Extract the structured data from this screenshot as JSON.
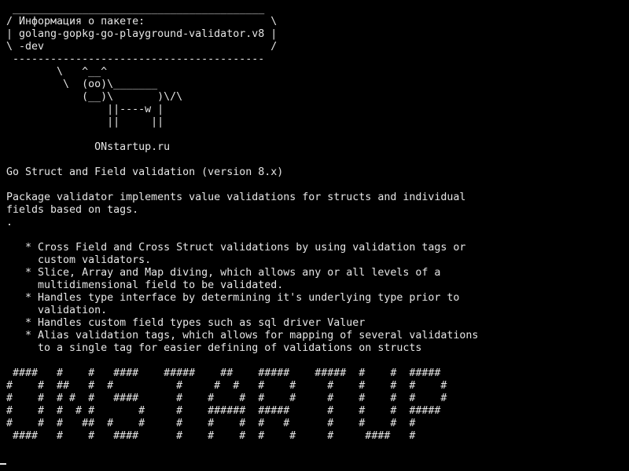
{
  "terminal": {
    "lines": [
      " ________________________________________",
      "/ Информация о пакете:                    \\",
      "| golang-gopkg-go-playground-validator.v8 |",
      "\\ -dev                                    /",
      " ----------------------------------------",
      "        \\   ^__^",
      "         \\  (oo)\\_______",
      "            (__)\\       )\\/\\",
      "                ||----w |",
      "                ||     ||",
      "",
      "              ONstartup.ru",
      "",
      "Go Struct and Field validation (version 8.x)",
      "",
      "Package validator implements value validations for structs and individual",
      "fields based on tags.",
      ".",
      "",
      "   * Cross Field and Cross Struct validations by using validation tags or",
      "     custom validators.",
      "   * Slice, Array and Map diving, which allows any or all levels of a",
      "     multidimensional field to be validated.",
      "   * Handles type interface by determining it's underlying type prior to",
      "     validation.",
      "   * Handles custom field types such as sql driver Valuer",
      "   * Alias validation tags, which allows for mapping of several validations",
      "     to a single tag for easier defining of validations on structs",
      "",
      " ####   #    #   ####    #####    ##    #####    #####  #    #  #####",
      "#    #  ##   #  #          #     #  #   #    #     #    #    #  #    #",
      "#    #  # #  #   ####      #    #    #  #    #     #    #    #  #    #",
      "#    #  #  # #       #     #    ######  #####      #    #    #  #####",
      "#    #  #   ##  #    #     #    #    #  #   #      #    #    #  #",
      " ####   #    #   ####      #    #    #  #    #     #     ####   #"
    ]
  }
}
